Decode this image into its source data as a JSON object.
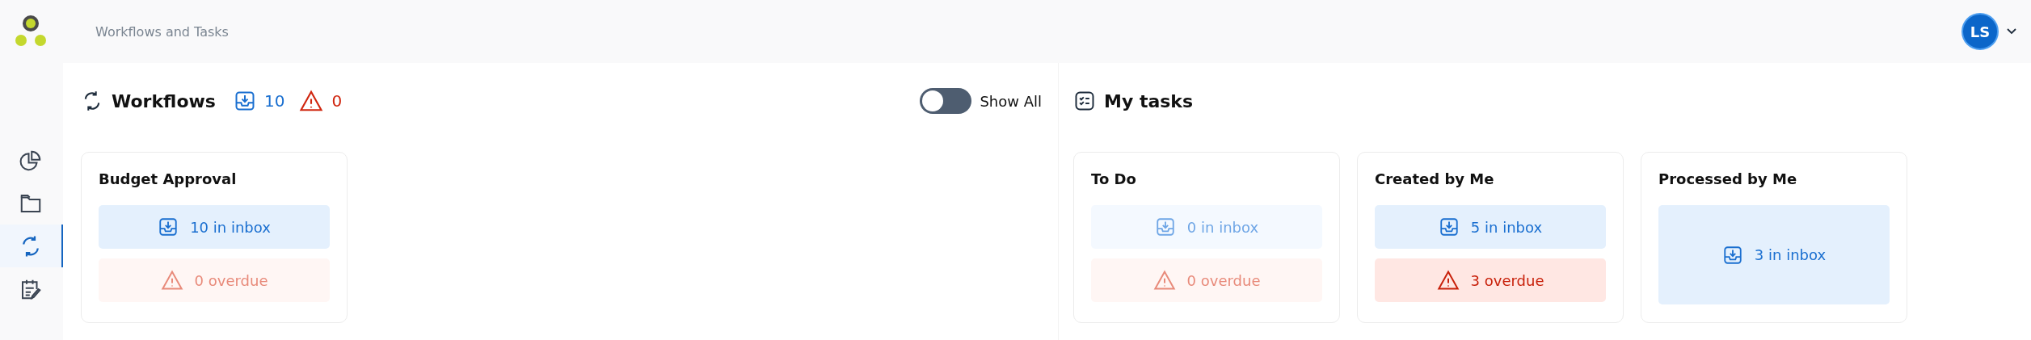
{
  "header": {
    "title": "Workflows and Tasks",
    "avatar": "LS"
  },
  "sidebar": {
    "items": [
      {
        "kind": "chart",
        "selected": false
      },
      {
        "kind": "folder",
        "selected": false
      },
      {
        "kind": "workflow",
        "selected": true
      },
      {
        "kind": "tasks",
        "selected": false
      }
    ]
  },
  "workflows": {
    "title": "Workflows",
    "inbox_count": "10",
    "overdue_count": "0",
    "cards": [
      {
        "title": "Budget Approval",
        "tiles": [
          {
            "kind": "inbox",
            "label": "10 in inbox",
            "disabled": false
          },
          {
            "kind": "overdue",
            "label": "0 overdue",
            "disabled": true
          }
        ]
      }
    ]
  },
  "show_all": {
    "label": "Show All",
    "on": false
  },
  "my_tasks": {
    "title": "My tasks",
    "cards": [
      {
        "title": "To Do",
        "tiles": [
          {
            "kind": "inbox",
            "label": "0 in inbox",
            "disabled": true
          },
          {
            "kind": "overdue",
            "label": "0 overdue",
            "disabled": true
          }
        ]
      },
      {
        "title": "Created by Me",
        "tiles": [
          {
            "kind": "inbox",
            "label": "5 in inbox",
            "disabled": false
          },
          {
            "kind": "overdue",
            "label": "3 overdue",
            "disabled": false
          }
        ]
      },
      {
        "title": "Processed by Me",
        "tiles": [
          {
            "kind": "inbox",
            "label": "3 in inbox",
            "disabled": false
          }
        ]
      }
    ]
  }
}
